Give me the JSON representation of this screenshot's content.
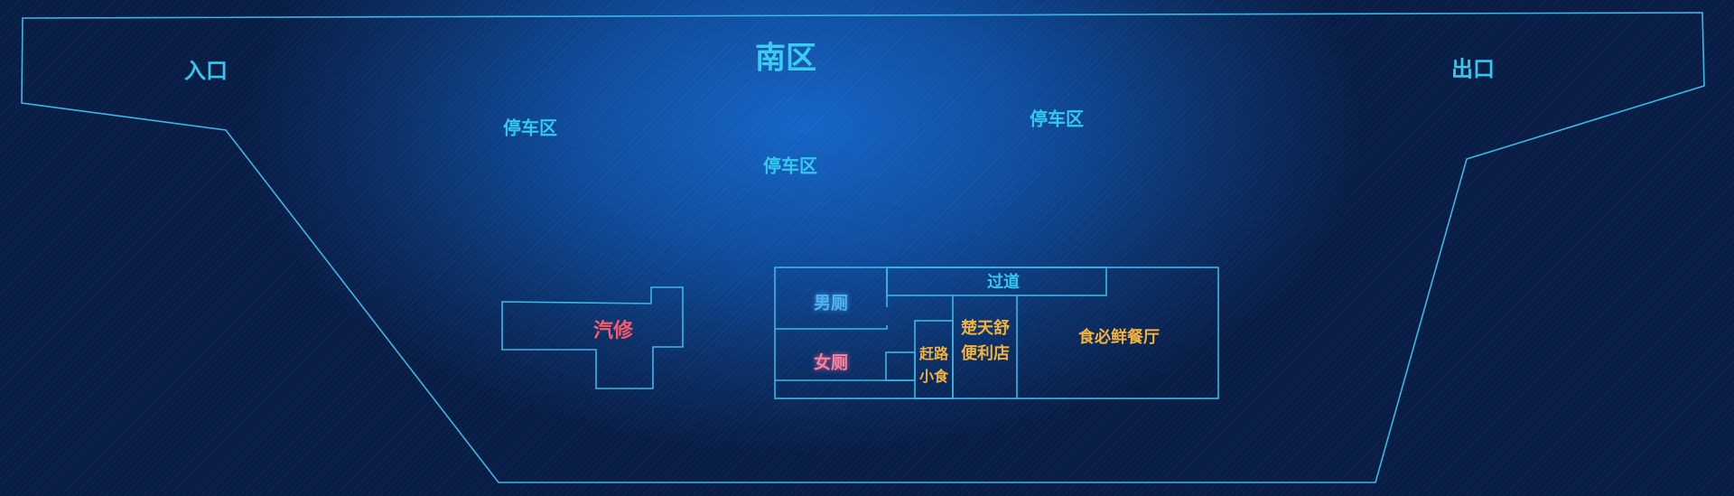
{
  "map": {
    "title": "南区",
    "entrance": "入口",
    "exit": "出口",
    "parking": [
      "停车区",
      "停车区",
      "停车区"
    ],
    "facilities": {
      "car_repair": "汽修",
      "mens_restroom": "男厕",
      "womens_restroom": "女厕",
      "corridor": "过道",
      "snack_line1": "赶路",
      "snack_line2": "小食",
      "store_line1": "楚天舒",
      "store_line2": "便利店",
      "restaurant": "食必鲜餐厅"
    },
    "colors": {
      "outline": "#3ab7e8",
      "zone_label": "#35c8ee",
      "car_repair": "#ff5a68",
      "womens_restroom": "#ff7f9e",
      "mens_restroom": "#4fb3f2",
      "shops": "#f2b33d",
      "background": "#0b2f66"
    }
  }
}
